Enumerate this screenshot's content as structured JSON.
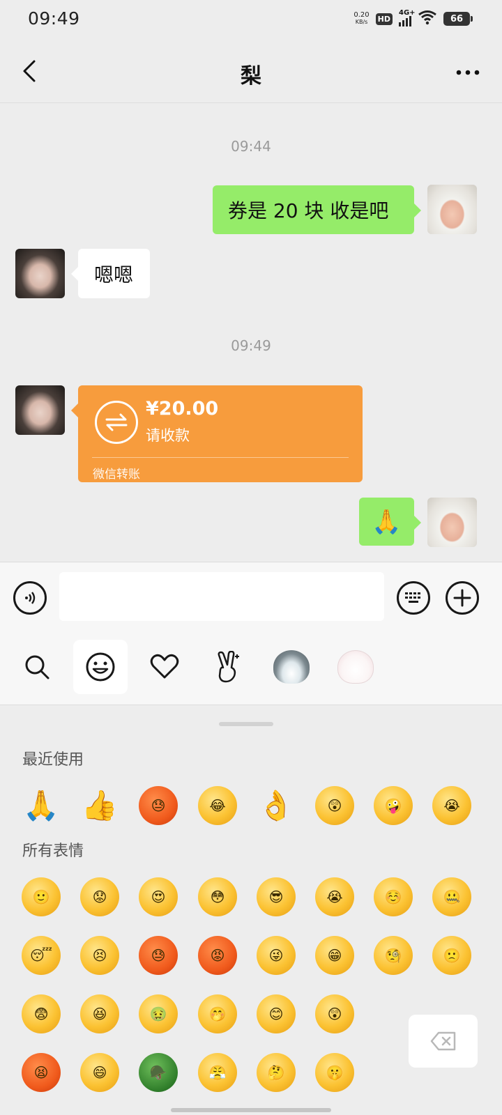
{
  "status_bar": {
    "time": "09:49",
    "net_speed_value": "0.20",
    "net_speed_unit": "KB/s",
    "hd": "HD",
    "network": "4G+",
    "battery": "66"
  },
  "nav": {
    "title": "梨",
    "back_icon": "chevron-left-icon",
    "more_icon": "more-horizontal-icon"
  },
  "chat": {
    "timestamps": [
      "09:44",
      "09:49"
    ],
    "messages": [
      {
        "side": "right",
        "text": "券是 20 块  收是吧"
      },
      {
        "side": "left",
        "text": "嗯嗯"
      },
      {
        "side": "left",
        "type": "transfer",
        "amount": "¥20.00",
        "status": "请收款",
        "footer": "微信转账"
      },
      {
        "side": "right",
        "type": "emoji",
        "emoji": "🙏"
      }
    ]
  },
  "input": {
    "value": "",
    "placeholder": ""
  },
  "emoji_tabs": [
    "search-icon",
    "smiley-icon",
    "heart-icon",
    "victory-hand-icon",
    "penguin-sticker",
    "bunny-sticker"
  ],
  "emoji_panel": {
    "recent_title": "最近使用",
    "all_title": "所有表情",
    "recent": [
      "🙏",
      "👍",
      "😓",
      "😂",
      "👌",
      "😲",
      "🤪",
      "😭"
    ],
    "rows": [
      [
        "🙂",
        "😟",
        "😍",
        "😳",
        "😎",
        "😭",
        "☺️",
        "🤐"
      ],
      [
        "😴",
        "😣",
        "😓",
        "😡",
        "😜",
        "😁",
        "🧐",
        "🙁"
      ],
      [
        "😨",
        "😆",
        "🤢",
        "🤭",
        "😊",
        "😲"
      ],
      [
        "😫",
        "😄",
        "🪖",
        "😤",
        "🤔",
        "🤫"
      ]
    ]
  },
  "colors": {
    "bubble_green": "#95ec69",
    "transfer_orange": "#f79c3d",
    "background": "#ededed"
  }
}
